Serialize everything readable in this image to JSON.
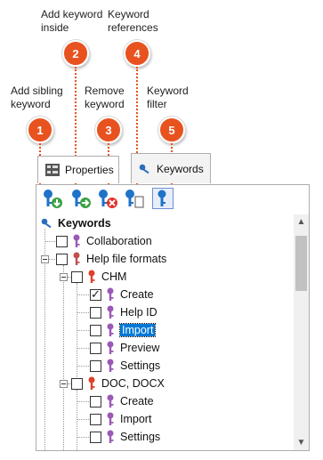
{
  "callouts": [
    {
      "num": "1",
      "lines": [
        "Add sibling",
        "keyword"
      ]
    },
    {
      "num": "2",
      "lines": [
        "Add keyword",
        "inside"
      ]
    },
    {
      "num": "3",
      "lines": [
        "Remove",
        "keyword"
      ]
    },
    {
      "num": "4",
      "lines": [
        "Keyword",
        "references"
      ]
    },
    {
      "num": "5",
      "lines": [
        "Keyword",
        "filter"
      ]
    }
  ],
  "tabs": {
    "properties": "Properties",
    "keywords": "Keywords"
  },
  "tree": {
    "root": "Keywords",
    "items": [
      {
        "label": "Collaboration",
        "checked": false,
        "color": "#9b59b6"
      },
      {
        "label": "Help file formats",
        "checked": false,
        "color": "#c0504d"
      },
      {
        "label": "CHM",
        "checked": false,
        "color": "#e0402a"
      },
      {
        "label": "Create",
        "checked": true,
        "color": "#9b59b6"
      },
      {
        "label": "Help ID",
        "checked": false,
        "color": "#9b59b6"
      },
      {
        "label": "Import",
        "checked": false,
        "color": "#9b59b6",
        "selected": true
      },
      {
        "label": "Preview",
        "checked": false,
        "color": "#9b59b6"
      },
      {
        "label": "Settings",
        "checked": false,
        "color": "#9b59b6"
      },
      {
        "label": "DOC, DOCX",
        "checked": false,
        "color": "#e0402a"
      },
      {
        "label": "Create",
        "checked": false,
        "color": "#9b59b6"
      },
      {
        "label": "Import",
        "checked": false,
        "color": "#9b59b6"
      },
      {
        "label": "Settings",
        "checked": false,
        "color": "#9b59b6"
      }
    ]
  },
  "colors": {
    "accent": "#e8521f",
    "key_blue": "#1e72c8",
    "selection": "#0078d7"
  }
}
